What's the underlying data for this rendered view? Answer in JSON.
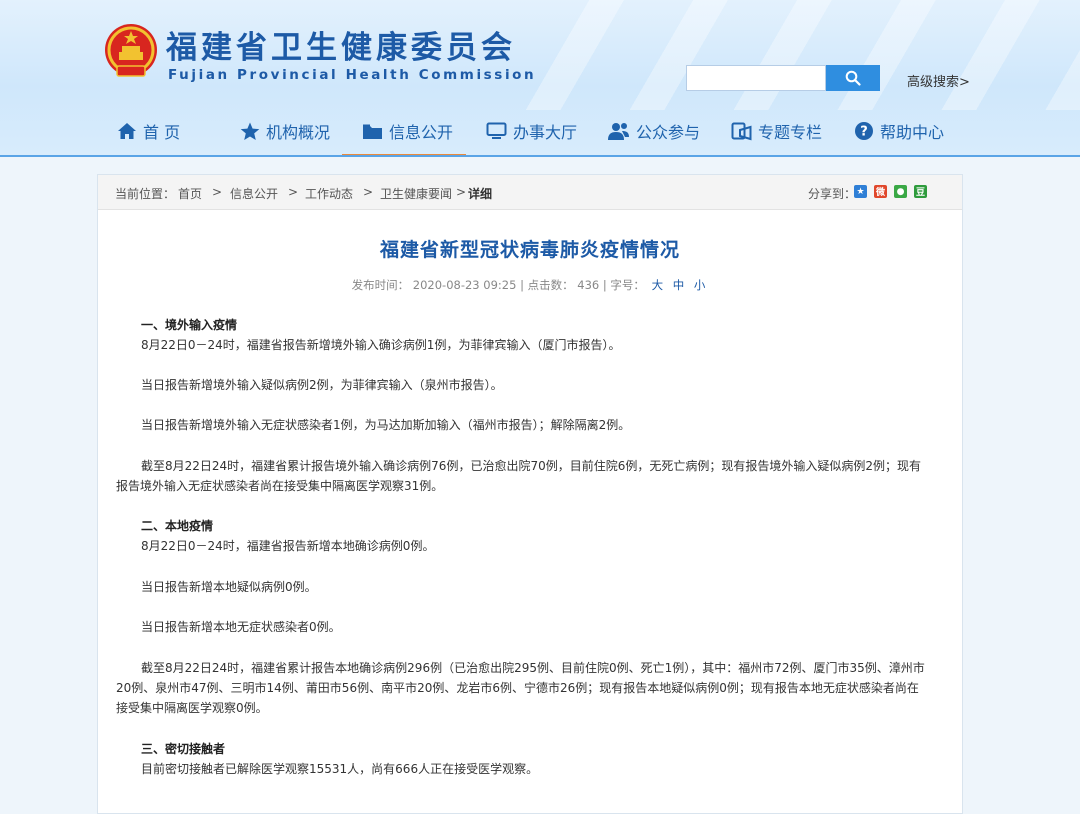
{
  "header": {
    "title": "福建省卫生健康委员会",
    "subtitle": "Fujian Provincial Health Commission",
    "search": {
      "placeholder": "",
      "advanced_label": "高级搜索>"
    }
  },
  "nav": {
    "items": [
      {
        "label": "首 页",
        "icon": "home-icon"
      },
      {
        "label": "机构概况",
        "icon": "star-icon"
      },
      {
        "label": "信息公开",
        "icon": "folder-icon",
        "active": true
      },
      {
        "label": "办事大厅",
        "icon": "monitor-icon"
      },
      {
        "label": "公众参与",
        "icon": "people-icon"
      },
      {
        "label": "专题专栏",
        "icon": "topic-icon"
      },
      {
        "label": "帮助中心",
        "icon": "help-icon"
      }
    ],
    "active_color": "#ea8a3c",
    "link_color": "#1f63ad"
  },
  "breadcrumb": {
    "prefix": "当前位置：",
    "items": [
      "首页",
      "信息公开",
      "工作动态",
      "卫生健康要闻"
    ],
    "separator": ">",
    "current": "详细",
    "share_label": "分享到："
  },
  "article": {
    "title": "福建省新型冠状病毒肺炎疫情情况",
    "meta": {
      "publish_label": "发布时间：",
      "publish_time": "2020-08-23 09:25",
      "clicks_label": "| 点击数：",
      "clicks": "436",
      "fontsize_label": "| 字号：",
      "font_sizes": [
        "大",
        "中",
        "小"
      ]
    },
    "paragraphs": [
      {
        "type": "heading",
        "text": "一、境外输入疫情"
      },
      {
        "type": "text",
        "text": "8月22日0－24时，福建省报告新增境外输入确诊病例1例，为菲律宾输入（厦门市报告）。"
      },
      {
        "type": "text",
        "text": "当日报告新增境外输入疑似病例2例，为菲律宾输入（泉州市报告）。"
      },
      {
        "type": "text",
        "text": "当日报告新增境外输入无症状感染者1例，为马达加斯加输入（福州市报告）；解除隔离2例。"
      },
      {
        "type": "text",
        "text_first": "截至8月22日24时，福建省累计报告境外输入确诊病例76例，已治愈出院70例，目前住院6例，无死亡病例；现有报告境外输入疑似病例2例；现有",
        "text_rest": "报告境外输入无症状感染者尚在接受集中隔离医学观察31例。"
      },
      {
        "type": "heading",
        "text": "二、本地疫情"
      },
      {
        "type": "text",
        "text": "8月22日0－24时，福建省报告新增本地确诊病例0例。"
      },
      {
        "type": "text",
        "text": "当日报告新增本地疑似病例0例。"
      },
      {
        "type": "text",
        "text": "当日报告新增本地无症状感染者0例。"
      },
      {
        "type": "text",
        "text_first": "截至8月22日24时，福建省累计报告本地确诊病例296例（已治愈出院295例、目前住院0例、死亡1例），其中：福州市72例、厦门市35例、漳州市",
        "text_mid": "20例、泉州市47例、三明市14例、莆田市56例、南平市20例、龙岩市6例、宁德市26例；现有报告本地疑似病例0例；现有报告本地无症状感染者尚在",
        "text_rest": "接受集中隔离医学观察0例。"
      },
      {
        "type": "heading",
        "text": "三、密切接触者"
      },
      {
        "type": "text",
        "text": "目前密切接触者已解除医学观察15531人，尚有666人正在接受医学观察。"
      }
    ]
  }
}
